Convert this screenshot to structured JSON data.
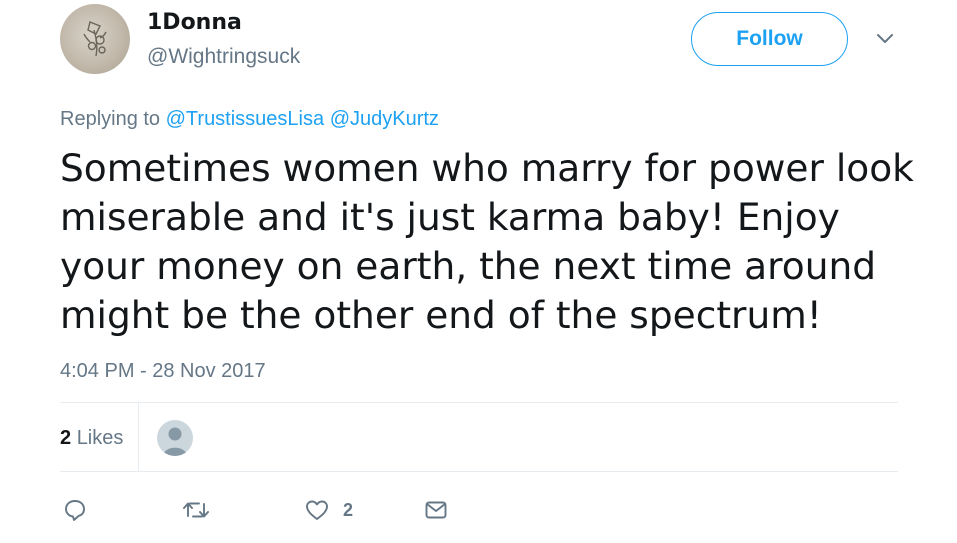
{
  "author": {
    "name": "1Donna",
    "handle": "@Wightringsuck"
  },
  "header": {
    "follow_label": "Follow"
  },
  "reply_context": {
    "prefix": "Replying to",
    "mentions": [
      "@TrustissuesLisa",
      "@JudyKurtz"
    ]
  },
  "tweet": {
    "text": "Sometimes women who marry for power look miserable and it's just karma baby! Enjoy your money on earth, the next time around might be the other end of the spectrum!",
    "timestamp": "4:04 PM - 28 Nov 2017"
  },
  "stats": {
    "likes_count": "2",
    "likes_label": "Likes"
  },
  "actions": {
    "like_count": "2"
  },
  "colors": {
    "accent": "#1da1f2",
    "secondary_text": "#657786",
    "primary_text": "#14171a",
    "divider": "#e6ecf0"
  },
  "icons": {
    "reply": "speech-bubble-icon",
    "retweet": "retweet-arrows-icon",
    "like": "heart-icon",
    "dm": "envelope-icon",
    "caret": "chevron-down-icon"
  }
}
